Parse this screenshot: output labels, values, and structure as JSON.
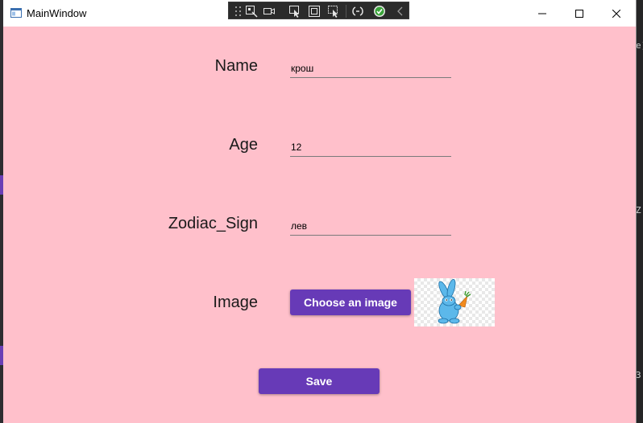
{
  "window": {
    "title": "MainWindow"
  },
  "form": {
    "name_label": "Name",
    "name_value": "крош",
    "age_label": "Age",
    "age_value": "12",
    "zodiac_label": "Zodiac_Sign",
    "zodiac_value": "лев",
    "image_label": "Image",
    "choose_image_label": "Choose an image",
    "save_label": "Save"
  },
  "colors": {
    "window_background": "#ffc0cb",
    "button_accent": "#673ab7",
    "button_text": "#ffffff"
  },
  "icons": {
    "preview": "krosh-rabbit-character",
    "app": "window-app-icon"
  },
  "background": {
    "right_edge_chars": [
      "e)",
      "Z",
      "3"
    ]
  }
}
